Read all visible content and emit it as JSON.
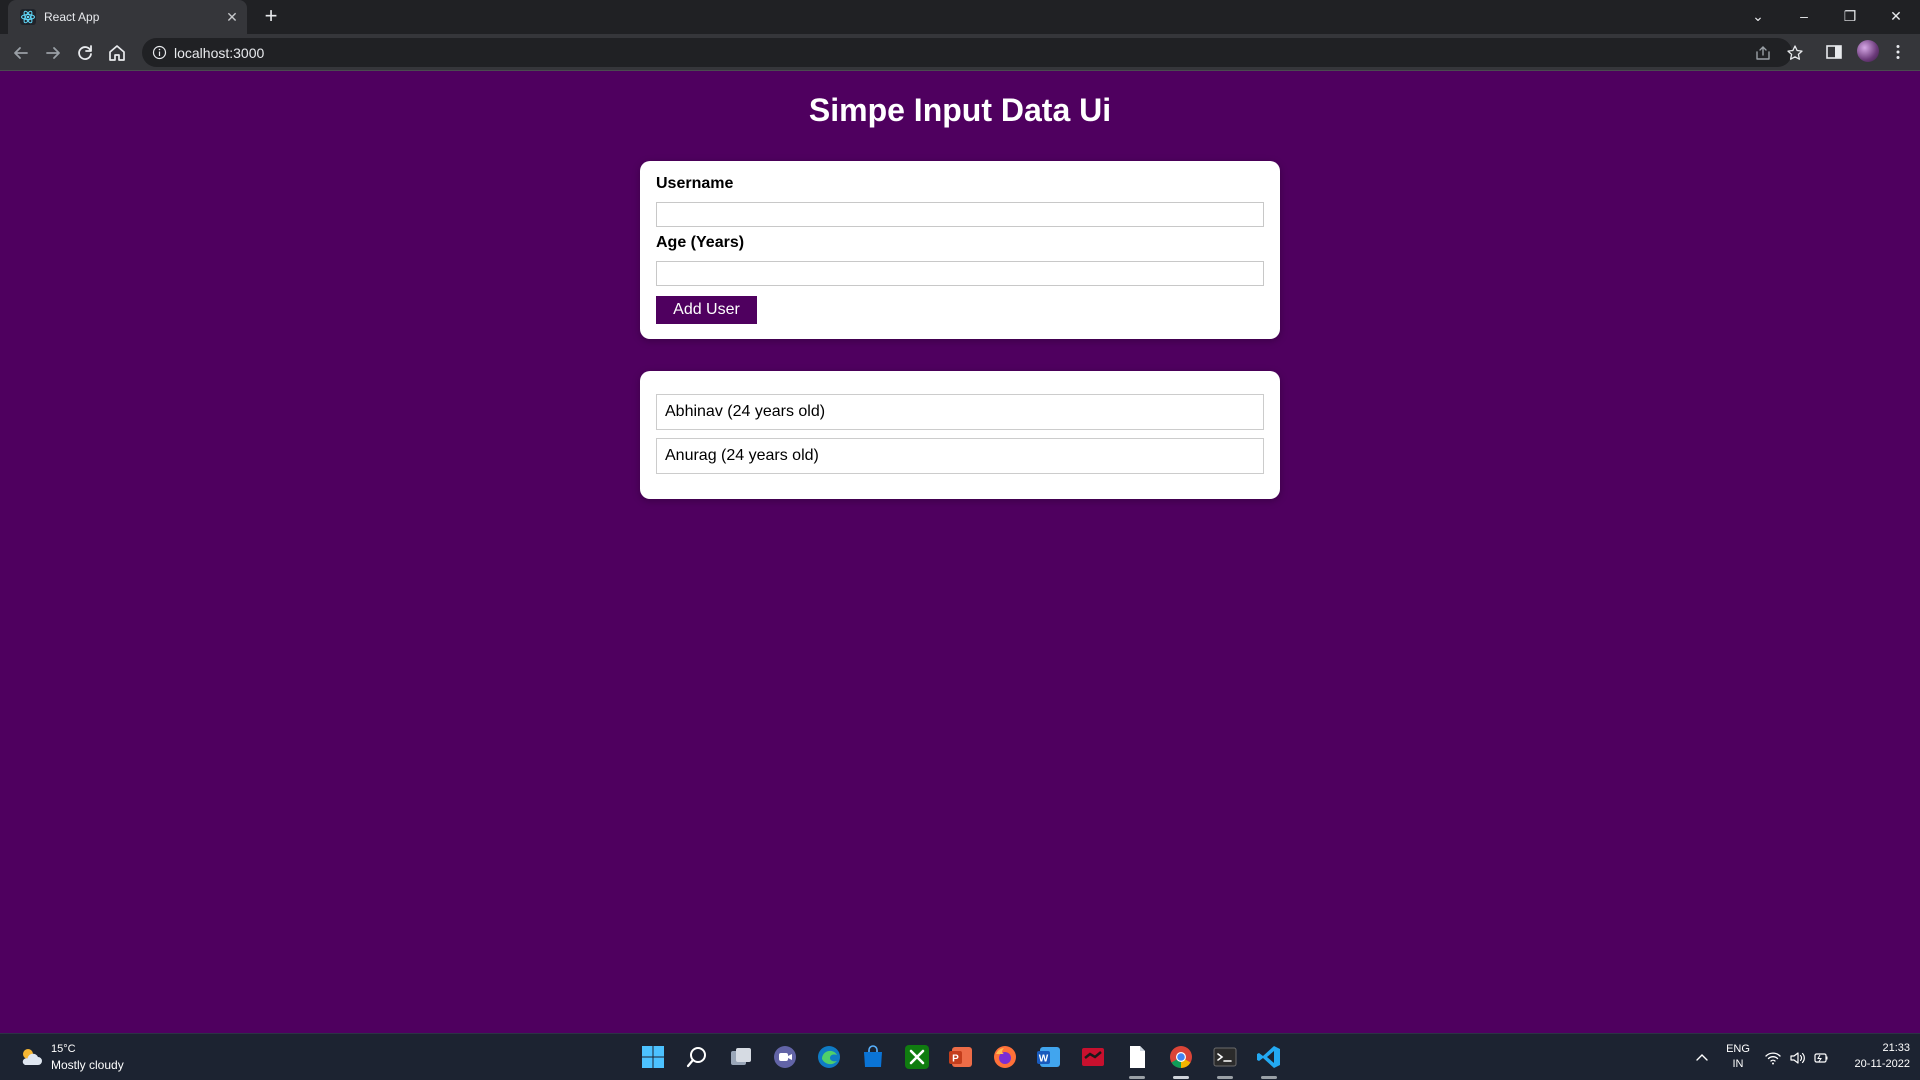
{
  "browser": {
    "tab_title": "React App",
    "tab_close_glyph": "✕",
    "new_tab_glyph": "+",
    "url": "localhost:3000",
    "window_controls": {
      "dropdown": "⌄",
      "minimize": "–",
      "restore": "❐",
      "close": "✕"
    }
  },
  "page": {
    "title": "Simpe Input Data Ui",
    "form": {
      "username_label": "Username",
      "username_value": "",
      "age_label": "Age (Years)",
      "age_value": "",
      "submit_label": "Add User"
    },
    "users": [
      {
        "text": "Abhinav (24 years old)"
      },
      {
        "text": "Anurag (24 years old)"
      }
    ]
  },
  "taskbar": {
    "weather_temp": "15°C",
    "weather_desc": "Mostly cloudy",
    "lang_top": "ENG",
    "lang_bottom": "IN",
    "time": "21:33",
    "date": "20-11-2022",
    "apps": [
      "start-icon",
      "search-icon",
      "task-view-icon",
      "chat-icon",
      "edge-icon",
      "store-icon",
      "xbox-icon",
      "powerpoint-icon",
      "firefox-icon",
      "word-icon",
      "app-icon",
      "notepad-icon",
      "chrome-icon",
      "terminal-icon",
      "vscode-icon"
    ]
  },
  "colors": {
    "page_background": "#4f005f",
    "button_background": "#4f005f",
    "card_background": "#ffffff",
    "chrome_dark": "#202124",
    "chrome_toolbar": "#35363a",
    "taskbar": "#1c2331"
  }
}
